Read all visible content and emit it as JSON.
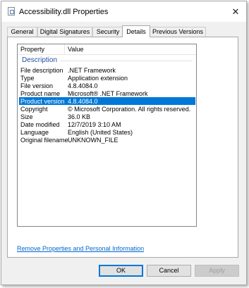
{
  "window": {
    "title": "Accessibility.dll Properties",
    "close_glyph": "✕"
  },
  "tabs": [
    {
      "label": "General"
    },
    {
      "label": "Digital Signatures"
    },
    {
      "label": "Security"
    },
    {
      "label": "Details",
      "active": true
    },
    {
      "label": "Previous Versions"
    }
  ],
  "details": {
    "columns": {
      "property": "Property",
      "value": "Value"
    },
    "group": "Description",
    "rows": [
      {
        "property": "File description",
        "value": ".NET Framework"
      },
      {
        "property": "Type",
        "value": "Application extension"
      },
      {
        "property": "File version",
        "value": "4.8.4084.0"
      },
      {
        "property": "Product name",
        "value": "Microsoft® .NET Framework"
      },
      {
        "property": "Product version",
        "value": "4.8.4084.0",
        "selected": true
      },
      {
        "property": "Copyright",
        "value": "© Microsoft Corporation.  All rights reserved."
      },
      {
        "property": "Size",
        "value": "36.0 KB"
      },
      {
        "property": "Date modified",
        "value": "12/7/2019 3:10 AM"
      },
      {
        "property": "Language",
        "value": "English (United States)"
      },
      {
        "property": "Original filename",
        "value": "UNKNOWN_FILE"
      }
    ]
  },
  "remove_link": "Remove Properties and Personal Information",
  "buttons": {
    "ok": "OK",
    "cancel": "Cancel",
    "apply": "Apply"
  },
  "colors": {
    "selection": "#0078d7",
    "link": "#0066cc",
    "group_header": "#1e4e9c"
  }
}
